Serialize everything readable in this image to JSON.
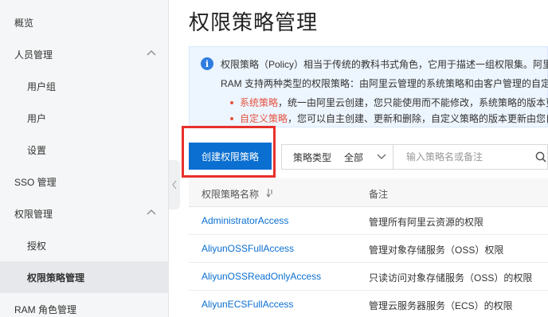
{
  "sidebar": {
    "items": [
      {
        "label": "概览"
      },
      {
        "label": "人员管理"
      },
      {
        "label": "用户组"
      },
      {
        "label": "用户"
      },
      {
        "label": "设置"
      },
      {
        "label": "SSO 管理"
      },
      {
        "label": "权限管理"
      },
      {
        "label": "授权"
      },
      {
        "label": "权限策略管理"
      },
      {
        "label": "RAM 角色管理"
      }
    ]
  },
  "page": {
    "title": "权限策略管理"
  },
  "info": {
    "line1": "权限策略（Policy）相当于传统的教科书式角色，它用于描述一组权限集。阿里",
    "line2": "RAM 支持两种类型的权限策略：由阿里云管理的系统策略和由客户管理的自定",
    "system_label": "系统策略",
    "system_text": "，统一由阿里云创建，您只能使用而不能修改，系统策略的版本更",
    "custom_label": "自定义策略",
    "custom_text": "，您可以自主创建、更新和删除，自定义策略的版本更新由您自"
  },
  "toolbar": {
    "create_label": "创建权限策略",
    "filter_label": "策略类型",
    "filter_value": "全部",
    "search_placeholder": "输入策略名或备注"
  },
  "table": {
    "headers": [
      "权限策略名称",
      "备注"
    ],
    "rows": [
      {
        "name": "AdministratorAccess",
        "note": "管理所有阿里云资源的权限"
      },
      {
        "name": "AliyunOSSFullAccess",
        "note": "管理对象存储服务（OSS）权限"
      },
      {
        "name": "AliyunOSSReadOnlyAccess",
        "note": "只读访问对象存储服务（OSS）的权限"
      },
      {
        "name": "AliyunECSFullAccess",
        "note": "管理云服务器服务（ECS）的权限"
      }
    ]
  },
  "colors": {
    "accent": "#0a6fd1",
    "highlight": "#e8302a",
    "warning": "#e55340"
  }
}
